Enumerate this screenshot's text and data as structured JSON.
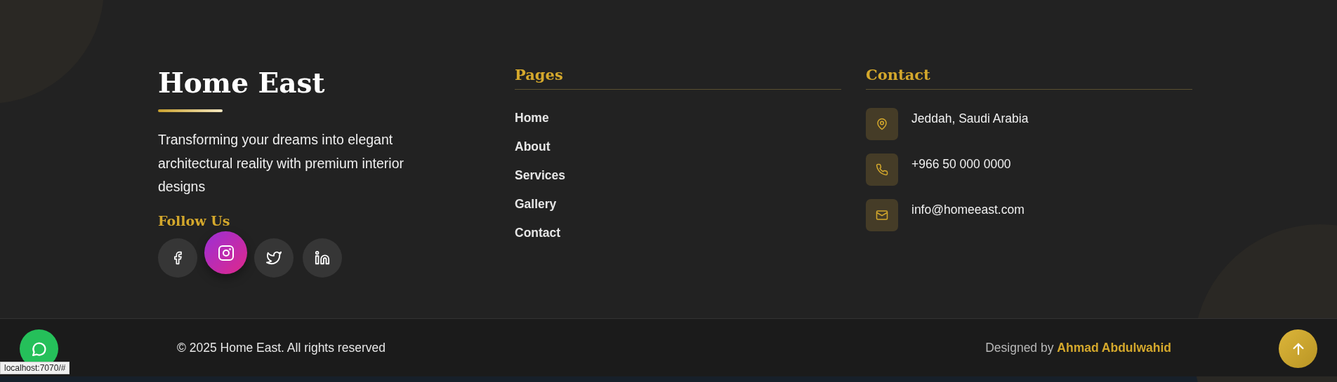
{
  "brand": {
    "title": "Home East",
    "description": "Transforming your dreams into elegant architectural reality with premium interior designs",
    "follow_heading": "Follow Us",
    "socials": [
      {
        "kind": "facebook",
        "hovered": false
      },
      {
        "kind": "instagram",
        "hovered": true
      },
      {
        "kind": "twitter",
        "hovered": false
      },
      {
        "kind": "linkedin",
        "hovered": false
      }
    ]
  },
  "pages": {
    "heading": "Pages",
    "links": [
      "Home",
      "About",
      "Services",
      "Gallery",
      "Contact"
    ]
  },
  "contact": {
    "heading": "Contact",
    "items": [
      {
        "kind": "location",
        "text": "Jeddah, Saudi Arabia"
      },
      {
        "kind": "phone",
        "text": "+966 50 000 0000"
      },
      {
        "kind": "email",
        "text": "info@homeeast.com"
      }
    ]
  },
  "bottom_bar": {
    "copyright": "© 2025 Home East. All rights reserved",
    "credit_prefix": "Designed by",
    "credit_name": "Ahmad Abdulwahid"
  },
  "status_url": "localhost:7070/#"
}
